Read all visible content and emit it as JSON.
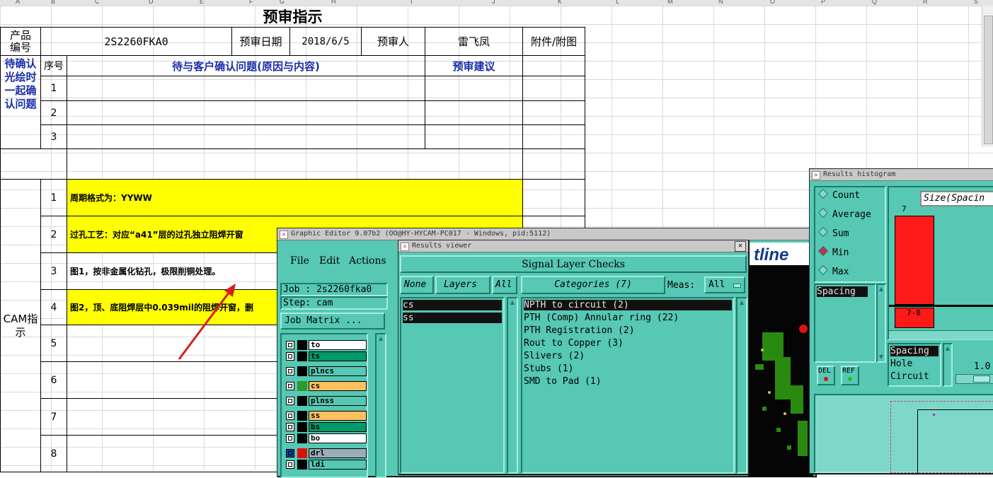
{
  "spreadsheet": {
    "column_letters": [
      "A",
      "B",
      "C",
      "D",
      "E",
      "F",
      "G",
      "H",
      "I",
      "J",
      "K",
      "L",
      "M",
      "N",
      "O",
      "P",
      "Q",
      "R",
      "S"
    ],
    "title": "预审指示",
    "product_label": "产品编号",
    "product_value": "2S2260FKA0",
    "date_label": "预审日期",
    "date_value": "2018/6/5",
    "reviewer_label": "预审人",
    "reviewer_value": "雷飞凤",
    "attachment_label": "附件/附图",
    "seq_label": "序号",
    "issue_header": "待与客户确认问题(原因与内容)",
    "advice_header": "预审建议",
    "confirm_section_label": "待确认光绘时一起确认问题",
    "confirm_rows": [
      "1",
      "2",
      "3"
    ],
    "cam_label": "CAM指示",
    "cam_rows": [
      {
        "num": "1",
        "text": "周期格式为：YYWW",
        "highlight": true
      },
      {
        "num": "2",
        "text": "过孔工艺：对应“a41”层的过孔独立阻焊开窗",
        "highlight": true
      },
      {
        "num": "3",
        "text": "图1，按非金属化钻孔，极限削铜处理。",
        "highlight": false
      },
      {
        "num": "4",
        "text": "图2，顶、底阻焊层中0.039mil的阻焊开窗，删",
        "highlight": true
      },
      {
        "num": "5",
        "text": "",
        "highlight": false
      },
      {
        "num": "6",
        "text": "",
        "highlight": false
      },
      {
        "num": "7",
        "text": "",
        "highlight": false
      },
      {
        "num": "8",
        "text": "",
        "highlight": false
      }
    ]
  },
  "graphic_editor": {
    "title": "Graphic Editor 9.07b2 (OO@HY-HYCAM-PC017 - Windows, pid:5112)",
    "menu": [
      "File",
      "Edit",
      "Actions"
    ],
    "job": "Job : 2s2260fka0",
    "step": "Step: cam",
    "job_matrix_button": "Job Matrix ...",
    "layers": [
      {
        "name": "to",
        "color": "#ffffff",
        "swatch": "#000000"
      },
      {
        "name": "ts",
        "color": "#009a6a",
        "swatch": "#000000"
      },
      {
        "name": "plncs",
        "color": "#56c8b4",
        "swatch": "#000000"
      },
      {
        "name": "cs",
        "color": "#ffc060",
        "swatch": "#2a9a2a"
      },
      {
        "name": "plnss",
        "color": "#56c8b4",
        "swatch": "#000000"
      },
      {
        "name": "ss",
        "color": "#ffc060",
        "swatch": "#000000"
      },
      {
        "name": "bs",
        "color": "#009a6a",
        "swatch": "#000000"
      },
      {
        "name": "bo",
        "color": "#ffffff",
        "swatch": "#000000"
      },
      {
        "name": "drl",
        "color": "#9aaeb8",
        "swatch": "#e01010"
      },
      {
        "name": "ldi",
        "color": "#56c8b4",
        "swatch": "#000000"
      }
    ],
    "logo_text": "tline"
  },
  "results_viewer": {
    "title": "Results viewer",
    "heading": "Signal Layer Checks",
    "none_button": "None",
    "layers_button": "Layers",
    "all_button": "All",
    "categories_button": "Categories (7)",
    "meas_label": "Meas:",
    "meas_value": "All",
    "layer_items": [
      "cs",
      "ss"
    ],
    "categories": [
      "NPTH to circuit (2)",
      "PTH (Comp) Annular ring (22)",
      "PTH Registration (2)",
      "Rout to Copper (3)",
      "Slivers (2)",
      "Stubs (1)",
      "SMD to Pad (1)"
    ]
  },
  "results_histogram": {
    "title": "Results histogram",
    "modes": [
      "Count",
      "Average",
      "Sum",
      "Min",
      "Max"
    ],
    "selected_mode": "Min",
    "list_item": "Spacing",
    "chart_title": "Size(Spacin",
    "bar_value": "7",
    "bar_label": "7-8",
    "del_button": "DEL",
    "ref_button": "REF",
    "types": [
      "Spacing",
      "Hole",
      "Circuit"
    ],
    "scale_value": "1.0"
  }
}
